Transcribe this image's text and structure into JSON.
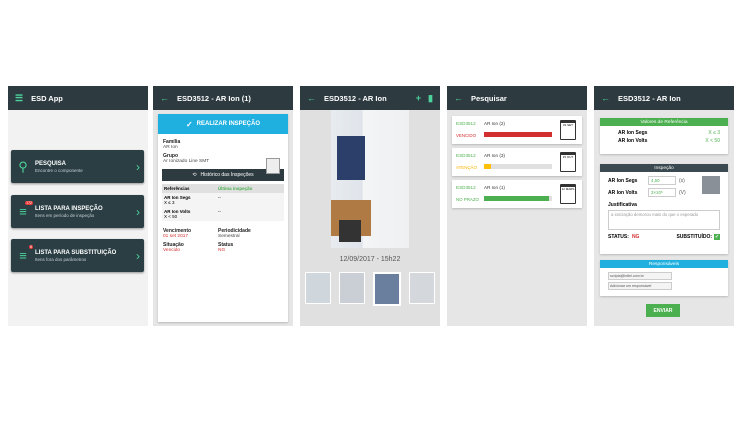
{
  "colors": {
    "accent": "#4cd29a",
    "appbar": "#2d3a40",
    "blue": "#1fb0e0",
    "red": "#d32f2f",
    "green": "#4caf50",
    "yellow": "#ffc107"
  },
  "s1": {
    "title": "ESD App",
    "menu_icon": "hamburger-icon",
    "items": [
      {
        "title": "PESQUISA",
        "sub": "Encontre o componente",
        "icon": "search-icon",
        "badge": ""
      },
      {
        "title": "LISTA PARA INSPEÇÃO",
        "sub": "Itens em período de inspeção",
        "icon": "checklist-icon",
        "badge": "172"
      },
      {
        "title": "LISTA PARA SUBSTITUIÇÃO",
        "sub": "Itens fora dos parâmetros",
        "icon": "replace-list-icon",
        "badge": "8"
      }
    ]
  },
  "s2": {
    "title": "ESD3512 - AR Ion (1)",
    "action": "REALIZAR INSPEÇÃO",
    "familia_lbl": "Família",
    "familia": "AR Ion",
    "grupo_lbl": "Grupo",
    "grupo": "Ar Ionizado Line SMT",
    "hist": "Histórico das Inspeções",
    "ref_h1": "Referências",
    "ref_h2": "Última inspeção",
    "refs": [
      {
        "name": "AR Ion Segs",
        "val": "X ≤ 3",
        "last": "--"
      },
      {
        "name": "AR Ion Volts",
        "val": "X < 50",
        "last": "--"
      }
    ],
    "venc_lbl": "Vencimento",
    "venc": "01 set 2017",
    "per_lbl": "Periodicidade",
    "per": "Semestral",
    "sit_lbl": "Situação",
    "sit": "Vencido",
    "stat_lbl": "Status",
    "stat": "NG"
  },
  "s3": {
    "title": "ESD3512 - AR Ion",
    "timestamp": "12/09/2017 - 15h22",
    "add": "+",
    "del": "trash-icon"
  },
  "s4": {
    "title": "Pesquisar",
    "rows": [
      {
        "code": "ESD3512",
        "name": "AR Ion (2)",
        "status": "VENCIDO",
        "level": 1.0,
        "color": "#d32f2f",
        "cal": "01 SET"
      },
      {
        "code": "ESD3512",
        "name": "AR Ion (3)",
        "status": "ATENÇÃO",
        "level": 0.1,
        "color": "#ffc107",
        "cal": "15 OUT"
      },
      {
        "code": "ESD3512",
        "name": "AR Ion (1)",
        "status": "NO PRAZO",
        "level": 0.95,
        "color": "#4caf50",
        "cal": "12 MARS"
      }
    ]
  },
  "s5": {
    "title": "ESD3512 - AR Ion",
    "ref_head": "Valores de Referência",
    "refs": [
      {
        "name": "AR Ion Segs",
        "val": "X ≤ 3"
      },
      {
        "name": "AR Ion Volts",
        "val": "X < 50"
      }
    ],
    "insp_head": "Inspeção",
    "meas": [
      {
        "name": "AR Ion Segs",
        "val": "4,50",
        "unit": "(s)"
      },
      {
        "name": "AR Ion Volts",
        "val": "3×10⁶",
        "unit": "(V)"
      }
    ],
    "just_lbl": "Justificativa",
    "just_ph": "a ionização demorou mais do que o esperado",
    "status_lbl": "STATUS:",
    "status": "NG",
    "subst_lbl": "SUBSTITUÍDO:",
    "resp_head": "Responsáveis",
    "resp_email": "scripta@inttel.com.br",
    "resp_add": "Adicionar um responsável",
    "send": "ENVIAR"
  }
}
